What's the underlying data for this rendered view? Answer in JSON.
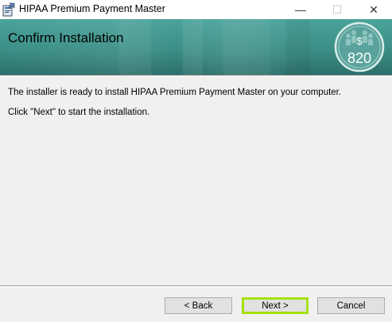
{
  "window": {
    "title": "HIPAA Premium Payment Master",
    "minimize_glyph": "—",
    "maximize_glyph": "☐",
    "close_glyph": "✕"
  },
  "banner": {
    "title": "Confirm Installation",
    "badge": {
      "symbol": "$",
      "number": "820"
    }
  },
  "body": {
    "message": "The installer is ready to install HIPAA Premium Payment Master on your computer.",
    "instruction": "Click \"Next\" to start the installation."
  },
  "buttons": {
    "back": "< Back",
    "next": "Next >",
    "cancel": "Cancel"
  },
  "colors": {
    "banner": "#3b8f86",
    "highlight": "#a6e10a",
    "background": "#f0f0f0"
  }
}
